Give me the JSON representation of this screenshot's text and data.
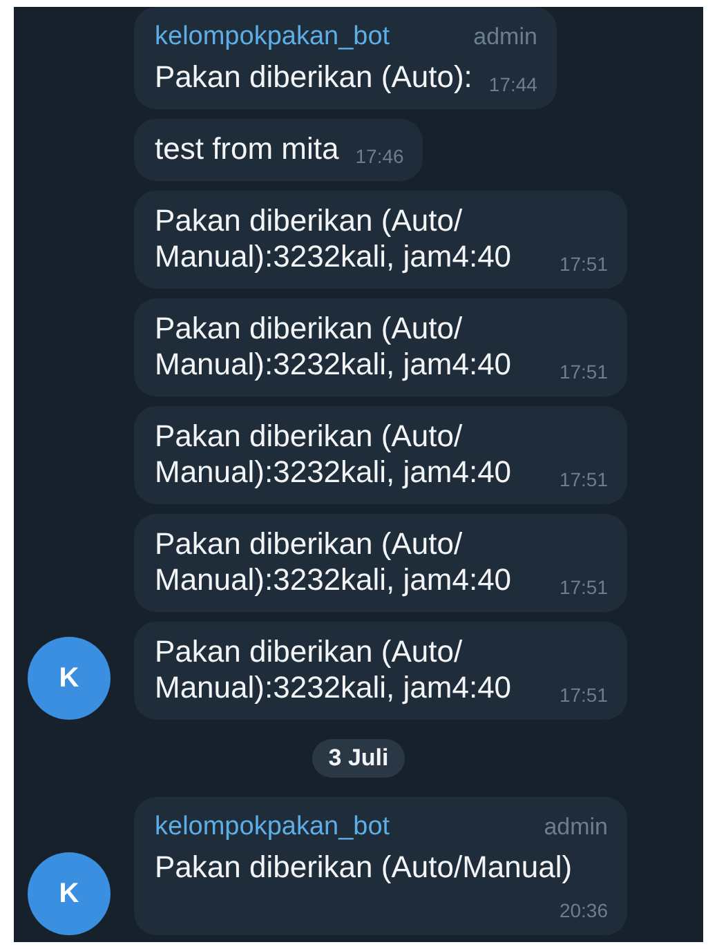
{
  "messages": [
    {
      "kind": "message",
      "sender": "kelompokpakan_bot",
      "role": "admin",
      "text": "Pakan diberikan (Auto):",
      "time": "17:44",
      "avatar": false
    },
    {
      "kind": "message",
      "text": "test from mita",
      "time": "17:46",
      "avatar": false
    },
    {
      "kind": "message",
      "text": "Pakan diberikan (Auto/Manual):3232kali, jam4:40",
      "time": "17:51",
      "avatar": false
    },
    {
      "kind": "message",
      "text": "Pakan diberikan (Auto/Manual):3232kali, jam4:40",
      "time": "17:51",
      "avatar": false
    },
    {
      "kind": "message",
      "text": "Pakan diberikan (Auto/Manual):3232kali, jam4:40",
      "time": "17:51",
      "avatar": false
    },
    {
      "kind": "message",
      "text": "Pakan diberikan (Auto/Manual):3232kali, jam4:40",
      "time": "17:51",
      "avatar": false
    },
    {
      "kind": "message",
      "text": "Pakan diberikan (Auto/Manual):3232kali, jam4:40",
      "time": "17:51",
      "avatar": true,
      "initial": "K"
    },
    {
      "kind": "date",
      "text": "3 Juli"
    },
    {
      "kind": "message",
      "sender": "kelompokpakan_bot",
      "role": "admin",
      "text": "Pakan diberikan (Auto/Manual)",
      "time": "20:36",
      "avatar": true,
      "initial": "K"
    }
  ]
}
